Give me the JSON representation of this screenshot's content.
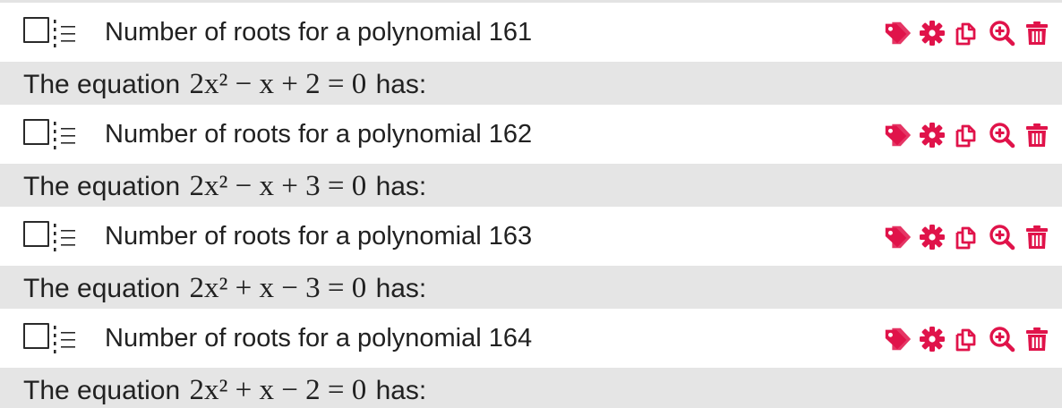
{
  "items": [
    {
      "title": "Number of roots for a polynomial 161",
      "statement_prefix": "The equation",
      "equation": "2x² − x + 2 = 0",
      "statement_suffix": "has:"
    },
    {
      "title": "Number of roots for a polynomial 162",
      "statement_prefix": "The equation",
      "equation": "2x² − x + 3 = 0",
      "statement_suffix": "has:"
    },
    {
      "title": "Number of roots for a polynomial 163",
      "statement_prefix": "The equation",
      "equation": "2x² + x − 3 = 0",
      "statement_suffix": "has:"
    },
    {
      "title": "Number of roots for a polynomial 164",
      "statement_prefix": "The equation",
      "equation": "2x² + x − 2 = 0",
      "statement_suffix": "has:"
    }
  ],
  "action_icons": [
    "tag-icon",
    "gear-icon",
    "copy-icon",
    "zoom-in-icon",
    "trash-icon"
  ],
  "colors": {
    "accent": "#e0134a",
    "body_background": "#e5e5e5",
    "text": "#212121",
    "checkbox_border": "#2a2a2a"
  }
}
